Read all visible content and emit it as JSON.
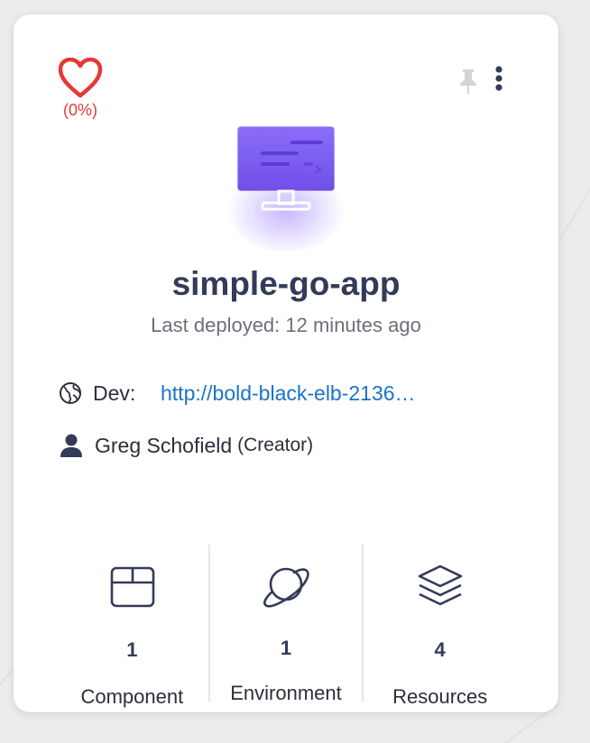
{
  "card": {
    "health_percent": "(0%)",
    "app_name": "simple-go-app",
    "last_deployed": "Last deployed: 12 minutes ago",
    "environment": {
      "name": "Dev:",
      "url": "http://bold-black-elb-2136…"
    },
    "creator": {
      "name": "Greg Schofield",
      "role": "(Creator)"
    },
    "stats": [
      {
        "count": "1",
        "label": "Component",
        "icon": "box-icon"
      },
      {
        "count": "1",
        "label": "Environment",
        "icon": "planet-icon"
      },
      {
        "count": "4",
        "label": "Resources",
        "icon": "layers-icon"
      }
    ]
  },
  "colors": {
    "health": "#e53935",
    "title": "#343a5a",
    "link": "#1a73c9",
    "illustration": "#7c5cf0"
  }
}
